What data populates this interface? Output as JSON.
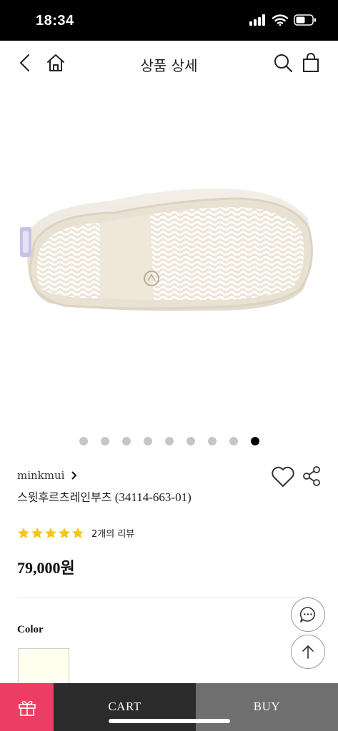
{
  "status_bar": {
    "time": "18:34",
    "icons": [
      "signal-icon",
      "wifi-icon",
      "battery-icon"
    ]
  },
  "nav": {
    "title": "상품 상세",
    "icons": [
      "back-icon",
      "home-icon",
      "search-icon",
      "shopping-bag-icon"
    ]
  },
  "carousel": {
    "total": 9,
    "active_index": 8
  },
  "product": {
    "brand": "minkmui",
    "name_ko": "스윗후르츠레인부츠",
    "name_code": "(34114-663-01)",
    "rating": 5,
    "max_rating": 5,
    "review_count_label": "2개의 리뷰",
    "price": "79,000원",
    "star_color": "#f5c518"
  },
  "options": {
    "color_label": "Color",
    "swatches": [
      {
        "color": "#fffff0"
      }
    ]
  },
  "floating": {
    "icons": [
      "chat-icon",
      "scroll-top-icon"
    ]
  },
  "bottom_bar": {
    "gift_icon": "gift-icon",
    "cart_label": "CART",
    "buy_label": "BUY",
    "gift_color": "#ec3d62",
    "cart_color": "#2b2b2b",
    "buy_color": "#6f6f6f"
  }
}
